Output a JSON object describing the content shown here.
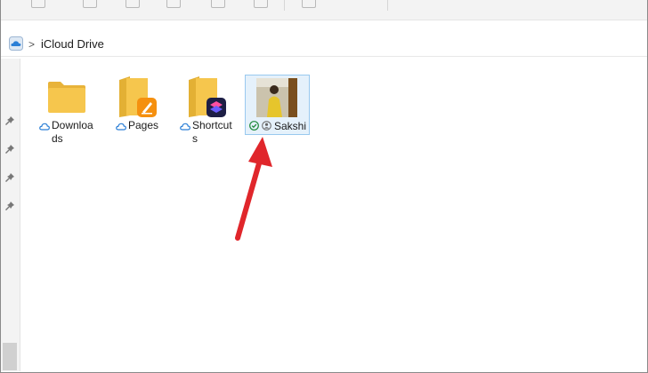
{
  "address": {
    "location": "iCloud Drive",
    "separator": ">",
    "icon": "icloud-icon"
  },
  "items": [
    {
      "name": "Downloads",
      "label_line1": "Downloa",
      "label_line2": "ds",
      "type": "folder",
      "status_icon": "cloud-icon"
    },
    {
      "name": "Pages",
      "label_line1": "Pages",
      "type": "folder",
      "app_icon": "pages-app-icon",
      "status_icon": "cloud-icon"
    },
    {
      "name": "Shortcuts",
      "label_line1": "Shortcut",
      "label_line2": "s",
      "type": "folder",
      "app_icon": "shortcuts-app-icon",
      "status_icon": "cloud-icon"
    },
    {
      "name": "Sakshi",
      "label_line1": "Sakshi",
      "type": "image",
      "selected": true,
      "status_icons": [
        "synced-check-icon",
        "shared-person-icon"
      ]
    }
  ],
  "colors": {
    "folder": "#f6c64d",
    "selection_bg": "#e5f1fb",
    "selection_border": "#99c9ef",
    "arrow": "#e0262b",
    "cloud": "#2b7fd6"
  }
}
